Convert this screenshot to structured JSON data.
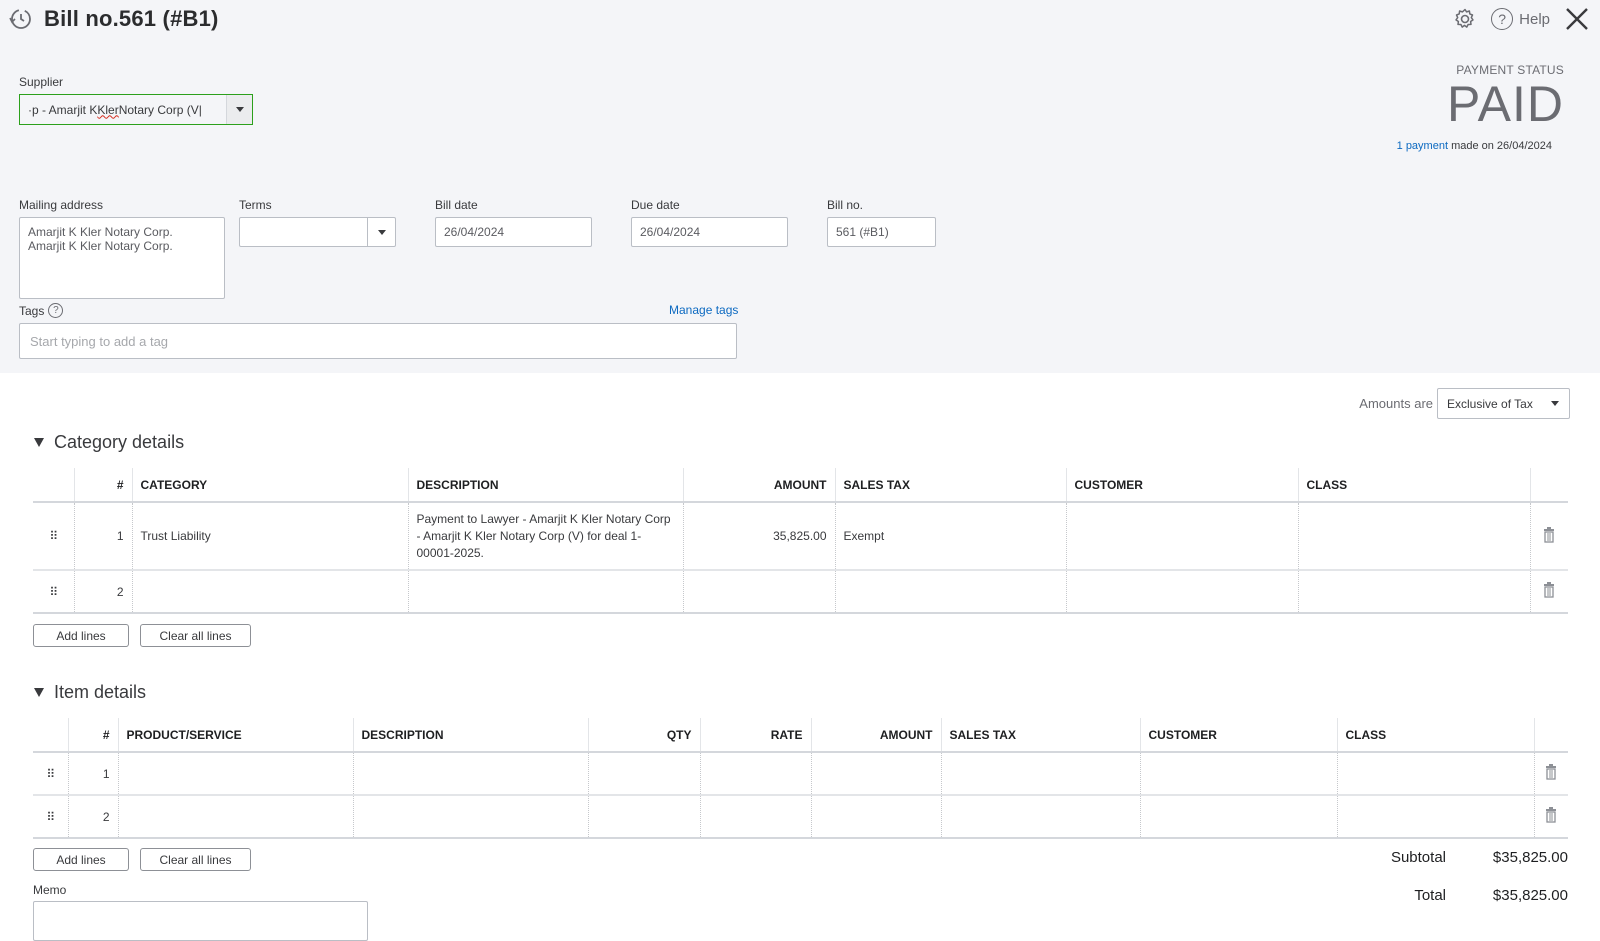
{
  "header": {
    "title": "Bill no.561 (#B1)",
    "help_label": "Help"
  },
  "supplier": {
    "label": "Supplier",
    "value_prefix": "·p - Amarjit K ",
    "value_misspelled": "Kler",
    "value_suffix": " Notary Corp (V",
    "cursor": "|"
  },
  "payment_status": {
    "label": "PAYMENT STATUS",
    "status": "PAID",
    "payment_link": "1 payment",
    "payment_note": " made on 26/04/2024"
  },
  "mailing_address": {
    "label": "Mailing address",
    "value": "Amarjit K Kler Notary Corp.\nAmarjit K Kler Notary Corp."
  },
  "terms": {
    "label": "Terms",
    "value": ""
  },
  "bill_date": {
    "label": "Bill date",
    "value": "26/04/2024"
  },
  "due_date": {
    "label": "Due date",
    "value": "26/04/2024"
  },
  "bill_no": {
    "label": "Bill no.",
    "value": "561 (#B1)"
  },
  "tags": {
    "label": "Tags",
    "help_glyph": "?",
    "manage_label": "Manage tags",
    "placeholder": "Start typing to add a tag"
  },
  "amounts_are": {
    "label": "Amounts are",
    "selected": "Exclusive of Tax"
  },
  "category_details": {
    "title": "Category details",
    "columns": [
      "#",
      "Category",
      "Description",
      "Amount",
      "Sales Tax",
      "Customer",
      "Class"
    ],
    "rows": [
      {
        "num": "1",
        "category": "Trust Liability",
        "description": "Payment to Lawyer - Amarjit K Kler Notary Corp - Amarjit K Kler Notary Corp (V) for deal 1-00001-2025.",
        "amount": "35,825.00",
        "sales_tax": "Exempt",
        "customer": "",
        "class": ""
      },
      {
        "num": "2",
        "category": "",
        "description": "",
        "amount": "",
        "sales_tax": "",
        "customer": "",
        "class": ""
      }
    ],
    "add_lines": "Add lines",
    "clear_lines": "Clear all lines"
  },
  "item_details": {
    "title": "Item details",
    "columns": [
      "#",
      "Product/Service",
      "Description",
      "Qty",
      "Rate",
      "Amount",
      "Sales Tax",
      "Customer",
      "Class"
    ],
    "rows": [
      {
        "num": "1"
      },
      {
        "num": "2"
      }
    ],
    "add_lines": "Add lines",
    "clear_lines": "Clear all lines"
  },
  "totals": {
    "subtotal_label": "Subtotal",
    "subtotal_value": "$35,825.00",
    "total_label": "Total",
    "total_value": "$35,825.00"
  },
  "memo": {
    "label": "Memo",
    "value": ""
  },
  "glyphs": {
    "drag": "⠿"
  }
}
